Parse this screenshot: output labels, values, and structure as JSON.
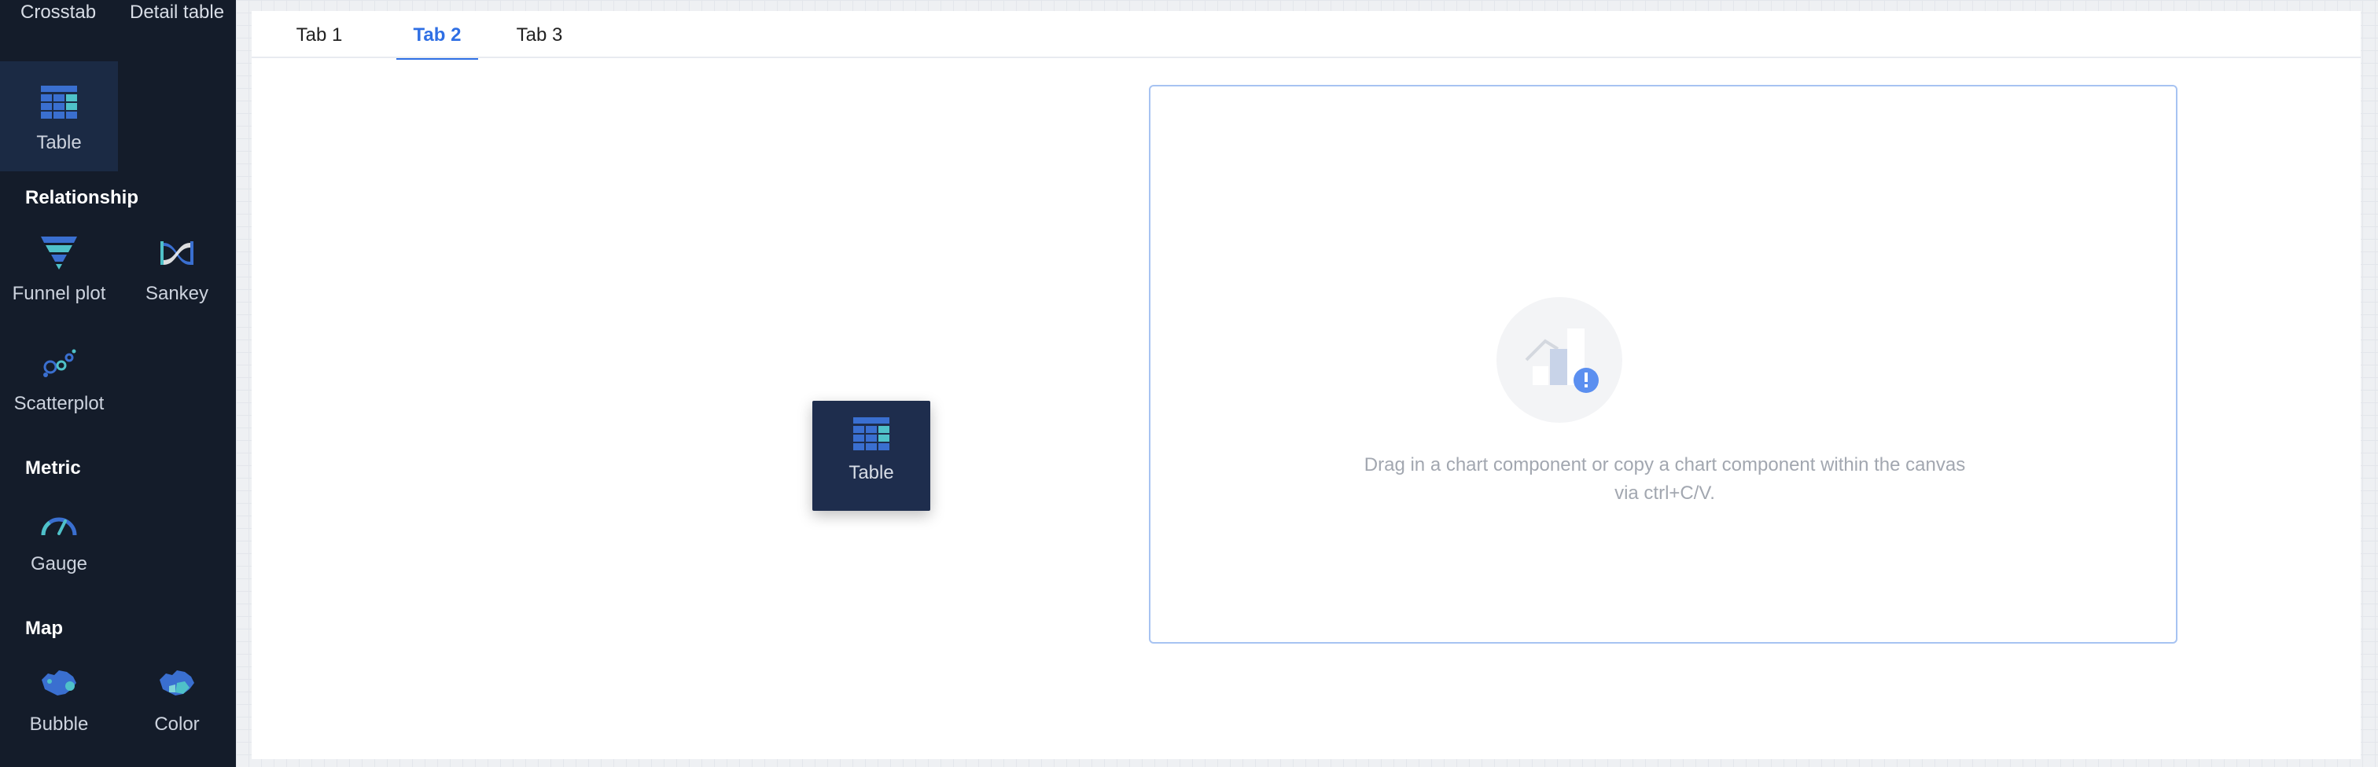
{
  "sidebar": {
    "top_labels": {
      "crosstab": "Crosstab",
      "detail_table": "Detail table"
    },
    "table_tile": {
      "label": "Table",
      "icon": "table-icon",
      "selected": true
    },
    "sections": {
      "relationship": {
        "heading": "Relationship",
        "items": [
          {
            "label": "Funnel plot",
            "icon": "funnel-icon"
          },
          {
            "label": "Sankey",
            "icon": "sankey-icon"
          },
          {
            "label": "Scatterplot",
            "icon": "scatter-icon"
          }
        ]
      },
      "metric": {
        "heading": "Metric",
        "items": [
          {
            "label": "Gauge",
            "icon": "gauge-icon"
          }
        ]
      },
      "map": {
        "heading": "Map",
        "items": [
          {
            "label": "Bubble",
            "icon": "bubble-map-icon"
          },
          {
            "label": "Color",
            "icon": "color-map-icon"
          }
        ]
      }
    }
  },
  "tabs": [
    {
      "label": "Tab 1",
      "active": false
    },
    {
      "label": "Tab 2",
      "active": true
    },
    {
      "label": "Tab 3",
      "active": false
    }
  ],
  "canvas": {
    "empty_message_line1": "Drag in a chart component or copy a chart component within the canvas",
    "empty_message_line2": "via ctrl+C/V.",
    "empty_icon": "empty-chart-icon"
  },
  "drag_ghost": {
    "label": "Table",
    "icon": "table-icon"
  },
  "colors": {
    "sidebar_bg": "#141c2a",
    "accent": "#2f6fe4",
    "dropzone_border": "#a7c3f2",
    "icon_blue": "#3a6fd0",
    "icon_teal": "#4fc1c9"
  }
}
